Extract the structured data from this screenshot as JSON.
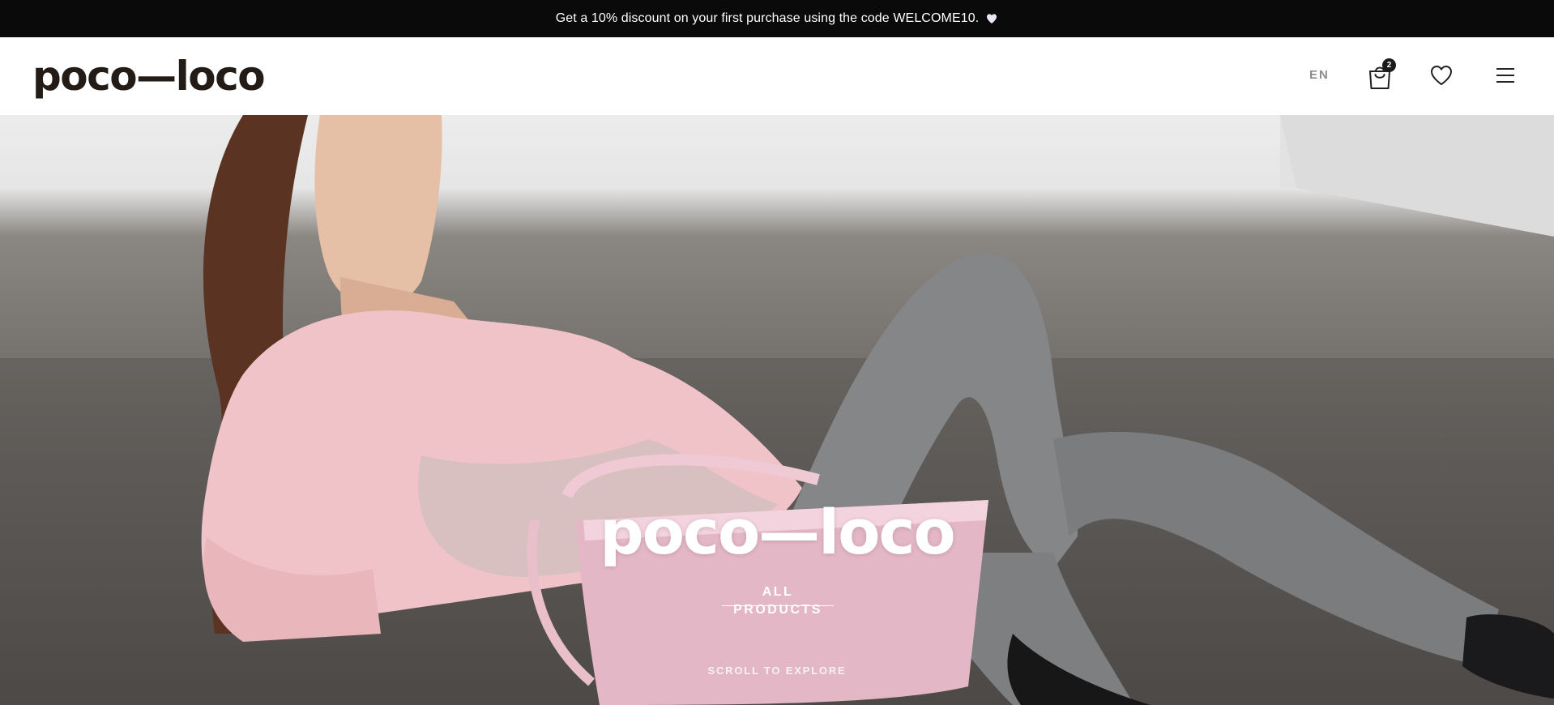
{
  "announcement": {
    "text": "Get a 10% discount on your first purchase using the code WELCOME10.",
    "icon": "heart-icon"
  },
  "header": {
    "logo": "poco—loco",
    "language": "EN",
    "cart_count": "2",
    "icons": [
      "shopping-bag-icon",
      "heart-icon",
      "hamburger-menu-icon"
    ]
  },
  "hero": {
    "title": "poco—loco",
    "cta_label": "ALL PRODUCTS",
    "scroll_hint": "SCROLL TO EXPLORE"
  },
  "colors": {
    "announcement_bg": "#0a0a0a",
    "logo": "#231c16",
    "badge": "#1b1b1b"
  }
}
